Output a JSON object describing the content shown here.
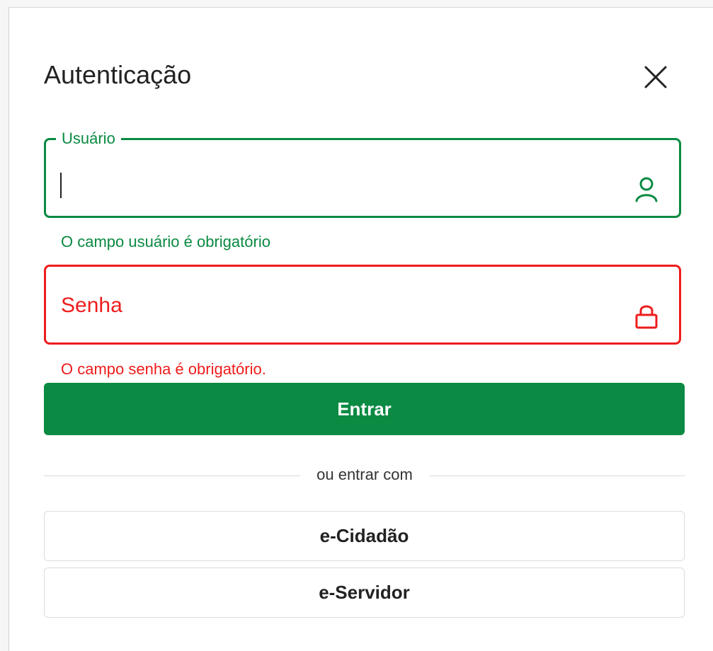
{
  "modal": {
    "title": "Autenticação"
  },
  "form": {
    "user": {
      "label": "Usuário",
      "value": "",
      "helper": "O campo usuário é obrigatório",
      "icon": "user-icon",
      "color": "#0a8a42"
    },
    "password": {
      "label": "Senha",
      "helper": "O campo senha é obrigatório.",
      "icon": "lock-icon",
      "color": "#ee1c1c"
    },
    "submit_label": "Entrar"
  },
  "alternatives": {
    "divider_text": "ou entrar com",
    "options": [
      "e-Cidadão",
      "e-Servidor"
    ]
  },
  "colors": {
    "accent": "#0a8a42",
    "error": "#ee1c1c"
  }
}
